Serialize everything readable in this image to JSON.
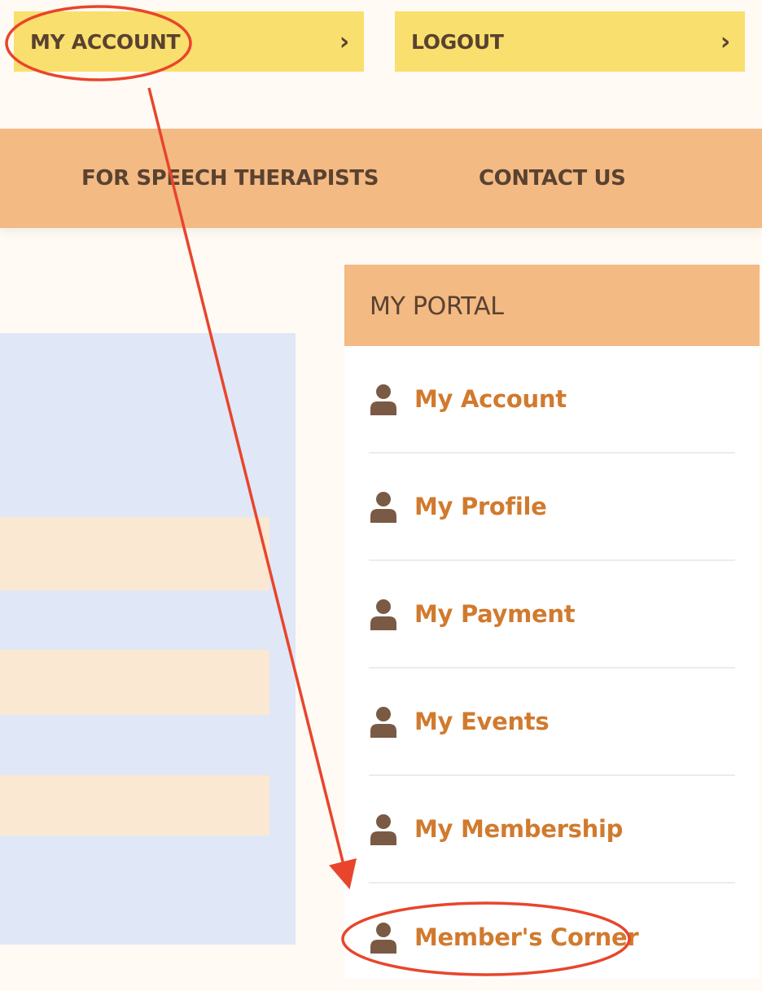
{
  "header": {
    "my_account_label": "MY ACCOUNT",
    "logout_label": "LOGOUT",
    "chevron": "chevron-right-icon"
  },
  "nav": {
    "items": [
      {
        "label": "FOR SPEECH THERAPISTS"
      },
      {
        "label": "CONTACT US"
      }
    ]
  },
  "portal": {
    "title": "MY PORTAL",
    "items": [
      {
        "label": "My Account",
        "icon": "user-icon"
      },
      {
        "label": "My Profile",
        "icon": "user-icon"
      },
      {
        "label": "My Payment",
        "icon": "user-icon"
      },
      {
        "label": "My Events",
        "icon": "user-icon"
      },
      {
        "label": "My Membership",
        "icon": "user-icon"
      },
      {
        "label": "Member's Corner",
        "icon": "user-icon"
      }
    ]
  },
  "colors": {
    "top_button_bg": "#f9df6d",
    "nav_bg": "#f3ba84",
    "text_dark": "#5a4230",
    "link_orange": "#d17a2e",
    "annotation_red": "#e8452c",
    "panel_blue": "#e0e7f6",
    "bar_peach": "#fbe8d2"
  }
}
